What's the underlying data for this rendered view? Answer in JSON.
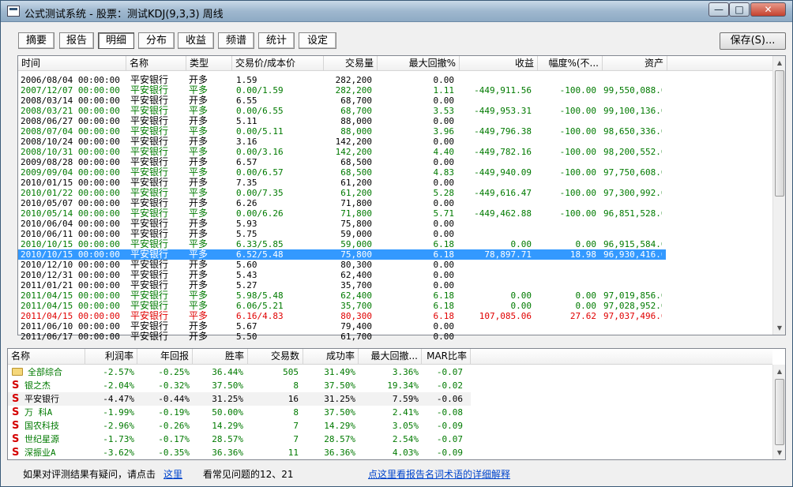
{
  "window": {
    "title": "公式测试系统 - 股票：测试KDJ(9,3,3) 周线",
    "minimize": "—",
    "maximize": "□",
    "close": "✕"
  },
  "tabs": [
    "摘要",
    "报告",
    "明细",
    "分布",
    "收益",
    "频谱",
    "统计",
    "设定"
  ],
  "active_tab": "明细",
  "save_label": "保存(S)...",
  "detail": {
    "headers": [
      "时间",
      "名称",
      "类型",
      "交易价/成本价",
      "交易量",
      "最大回撤%",
      "收益",
      "幅度%(不...",
      "资产"
    ],
    "rows": [
      {
        "time": "2006/08/04 00:00:00",
        "name": "平安银行",
        "type": "开多",
        "price": "1.59",
        "vol": "282,200",
        "dd": "0.00",
        "profit": "",
        "pct": "",
        "asset": "",
        "color": "black"
      },
      {
        "time": "2007/12/07 00:00:00",
        "name": "平安银行",
        "type": "平多",
        "price": "0.00/1.59",
        "vol": "282,200",
        "dd": "1.11",
        "profit": "-449,911.56",
        "pct": "-100.00",
        "asset": "99,550,088.00",
        "color": "green"
      },
      {
        "time": "2008/03/14 00:00:00",
        "name": "平安银行",
        "type": "开多",
        "price": "6.55",
        "vol": "68,700",
        "dd": "0.00",
        "profit": "",
        "pct": "",
        "asset": "",
        "color": "black"
      },
      {
        "time": "2008/03/21 00:00:00",
        "name": "平安银行",
        "type": "平多",
        "price": "0.00/6.55",
        "vol": "68,700",
        "dd": "3.53",
        "profit": "-449,953.31",
        "pct": "-100.00",
        "asset": "99,100,136.00",
        "color": "green"
      },
      {
        "time": "2008/06/27 00:00:00",
        "name": "平安银行",
        "type": "开多",
        "price": "5.11",
        "vol": "88,000",
        "dd": "0.00",
        "profit": "",
        "pct": "",
        "asset": "",
        "color": "black"
      },
      {
        "time": "2008/07/04 00:00:00",
        "name": "平安银行",
        "type": "平多",
        "price": "0.00/5.11",
        "vol": "88,000",
        "dd": "3.96",
        "profit": "-449,796.38",
        "pct": "-100.00",
        "asset": "98,650,336.00",
        "color": "green"
      },
      {
        "time": "2008/10/24 00:00:00",
        "name": "平安银行",
        "type": "开多",
        "price": "3.16",
        "vol": "142,200",
        "dd": "0.00",
        "profit": "",
        "pct": "",
        "asset": "",
        "color": "black"
      },
      {
        "time": "2008/10/31 00:00:00",
        "name": "平安银行",
        "type": "平多",
        "price": "0.00/3.16",
        "vol": "142,200",
        "dd": "4.40",
        "profit": "-449,782.16",
        "pct": "-100.00",
        "asset": "98,200,552.00",
        "color": "green"
      },
      {
        "time": "2009/08/28 00:00:00",
        "name": "平安银行",
        "type": "开多",
        "price": "6.57",
        "vol": "68,500",
        "dd": "0.00",
        "profit": "",
        "pct": "",
        "asset": "",
        "color": "black"
      },
      {
        "time": "2009/09/04 00:00:00",
        "name": "平安银行",
        "type": "平多",
        "price": "0.00/6.57",
        "vol": "68,500",
        "dd": "4.83",
        "profit": "-449,940.09",
        "pct": "-100.00",
        "asset": "97,750,608.00",
        "color": "green"
      },
      {
        "time": "2010/01/15 00:00:00",
        "name": "平安银行",
        "type": "开多",
        "price": "7.35",
        "vol": "61,200",
        "dd": "0.00",
        "profit": "",
        "pct": "",
        "asset": "",
        "color": "black"
      },
      {
        "time": "2010/01/22 00:00:00",
        "name": "平安银行",
        "type": "平多",
        "price": "0.00/7.35",
        "vol": "61,200",
        "dd": "5.28",
        "profit": "-449,616.47",
        "pct": "-100.00",
        "asset": "97,300,992.00",
        "color": "green"
      },
      {
        "time": "2010/05/07 00:00:00",
        "name": "平安银行",
        "type": "开多",
        "price": "6.26",
        "vol": "71,800",
        "dd": "0.00",
        "profit": "",
        "pct": "",
        "asset": "",
        "color": "black"
      },
      {
        "time": "2010/05/14 00:00:00",
        "name": "平安银行",
        "type": "平多",
        "price": "0.00/6.26",
        "vol": "71,800",
        "dd": "5.71",
        "profit": "-449,462.88",
        "pct": "-100.00",
        "asset": "96,851,528.00",
        "color": "green"
      },
      {
        "time": "2010/06/04 00:00:00",
        "name": "平安银行",
        "type": "开多",
        "price": "5.93",
        "vol": "75,800",
        "dd": "0.00",
        "profit": "",
        "pct": "",
        "asset": "",
        "color": "black"
      },
      {
        "time": "2010/06/11 00:00:00",
        "name": "平安银行",
        "type": "开多",
        "price": "5.75",
        "vol": "59,000",
        "dd": "0.00",
        "profit": "",
        "pct": "",
        "asset": "",
        "color": "black"
      },
      {
        "time": "2010/10/15 00:00:00",
        "name": "平安银行",
        "type": "平多",
        "price": "6.33/5.85",
        "vol": "59,000",
        "dd": "6.18",
        "profit": "0.00",
        "pct": "0.00",
        "asset": "96,915,584.00",
        "color": "green"
      },
      {
        "time": "2010/10/15 00:00:00",
        "name": "平安银行",
        "type": "平多",
        "price": "6.52/5.48",
        "vol": "75,800",
        "dd": "6.18",
        "profit": "78,897.71",
        "pct": "18.98",
        "asset": "96,930,416.00",
        "color": "selected"
      },
      {
        "time": "2010/12/10 00:00:00",
        "name": "平安银行",
        "type": "开多",
        "price": "5.60",
        "vol": "80,300",
        "dd": "0.00",
        "profit": "",
        "pct": "",
        "asset": "",
        "color": "black"
      },
      {
        "time": "2010/12/31 00:00:00",
        "name": "平安银行",
        "type": "开多",
        "price": "5.43",
        "vol": "62,400",
        "dd": "0.00",
        "profit": "",
        "pct": "",
        "asset": "",
        "color": "black"
      },
      {
        "time": "2011/01/21 00:00:00",
        "name": "平安银行",
        "type": "开多",
        "price": "5.27",
        "vol": "35,700",
        "dd": "0.00",
        "profit": "",
        "pct": "",
        "asset": "",
        "color": "black"
      },
      {
        "time": "2011/04/15 00:00:00",
        "name": "平安银行",
        "type": "平多",
        "price": "5.98/5.48",
        "vol": "62,400",
        "dd": "6.18",
        "profit": "0.00",
        "pct": "0.00",
        "asset": "97,019,856.00",
        "color": "green"
      },
      {
        "time": "2011/04/15 00:00:00",
        "name": "平安银行",
        "type": "平多",
        "price": "6.06/5.21",
        "vol": "35,700",
        "dd": "6.18",
        "profit": "0.00",
        "pct": "0.00",
        "asset": "97,028,952.00",
        "color": "green"
      },
      {
        "time": "2011/04/15 00:00:00",
        "name": "平安银行",
        "type": "平多",
        "price": "6.16/4.83",
        "vol": "80,300",
        "dd": "6.18",
        "profit": "107,085.06",
        "pct": "27.62",
        "asset": "97,037,496.00",
        "color": "red"
      },
      {
        "time": "2011/06/10 00:00:00",
        "name": "平安银行",
        "type": "开多",
        "price": "5.67",
        "vol": "79,400",
        "dd": "0.00",
        "profit": "",
        "pct": "",
        "asset": "",
        "color": "black"
      },
      {
        "time": "2011/06/17 00:00:00",
        "name": "平安银行",
        "type": "开多",
        "price": "5.50",
        "vol": "61,700",
        "dd": "0.00",
        "profit": "",
        "pct": "",
        "asset": "",
        "color": "black"
      }
    ]
  },
  "summary": {
    "headers": [
      "名称",
      "利润率",
      "年回报",
      "胜率",
      "交易数",
      "成功率",
      "最大回撤...",
      "MAR比率"
    ],
    "rows": [
      {
        "icon": "folder",
        "name": "全部综合",
        "profit": "-2.57%",
        "annual": "-0.25%",
        "win": "36.44%",
        "trades": "505",
        "success": "31.49%",
        "dd": "3.36%",
        "mar": "-0.07",
        "color": "green"
      },
      {
        "icon": "S",
        "name": "银之杰",
        "profit": "-2.04%",
        "annual": "-0.32%",
        "win": "37.50%",
        "trades": "8",
        "success": "37.50%",
        "dd": "19.34%",
        "mar": "-0.02",
        "color": "green"
      },
      {
        "icon": "S",
        "name": "平安银行",
        "profit": "-4.47%",
        "annual": "-0.44%",
        "win": "31.25%",
        "trades": "16",
        "success": "31.25%",
        "dd": "7.59%",
        "mar": "-0.06",
        "color": "black"
      },
      {
        "icon": "S",
        "name": "万  科A",
        "profit": "-1.99%",
        "annual": "-0.19%",
        "win": "50.00%",
        "trades": "8",
        "success": "37.50%",
        "dd": "2.41%",
        "mar": "-0.08",
        "color": "green"
      },
      {
        "icon": "S",
        "name": "国农科技",
        "profit": "-2.96%",
        "annual": "-0.26%",
        "win": "14.29%",
        "trades": "7",
        "success": "14.29%",
        "dd": "3.05%",
        "mar": "-0.09",
        "color": "green"
      },
      {
        "icon": "S",
        "name": "世纪星源",
        "profit": "-1.73%",
        "annual": "-0.17%",
        "win": "28.57%",
        "trades": "7",
        "success": "28.57%",
        "dd": "2.54%",
        "mar": "-0.07",
        "color": "green"
      },
      {
        "icon": "S",
        "name": "深振业A",
        "profit": "-3.62%",
        "annual": "-0.35%",
        "win": "36.36%",
        "trades": "11",
        "success": "36.36%",
        "dd": "4.03%",
        "mar": "-0.09",
        "color": "green"
      }
    ]
  },
  "footer": {
    "question_text": "如果对评测结果有疑问，请点击",
    "here_link": "这里",
    "faq_text": "看常见问题的12、21",
    "glossary_link": "点这里看报告名词术语的详细解释"
  },
  "colors": {
    "green": "#007a00",
    "red": "#e00000",
    "selected_bg": "#3399ff"
  }
}
